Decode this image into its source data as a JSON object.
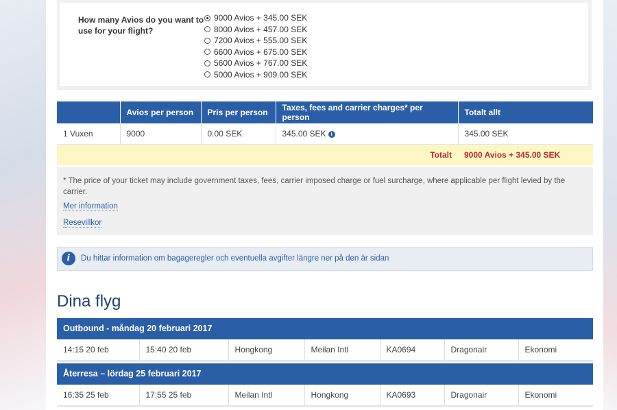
{
  "avios_selector": {
    "question": "How many Avios do you want to use for your flight?",
    "options": [
      {
        "label": "9000 Avios + 345.00 SEK",
        "selected": true
      },
      {
        "label": "8000 Avios + 457.00 SEK",
        "selected": false
      },
      {
        "label": "7200 Avios + 555.00 SEK",
        "selected": false
      },
      {
        "label": "6600 Avios + 675.00 SEK",
        "selected": false
      },
      {
        "label": "5600 Avios + 767.00 SEK",
        "selected": false
      },
      {
        "label": "5000 Avios + 909.00 SEK",
        "selected": false
      }
    ]
  },
  "price_table": {
    "headers": [
      "",
      "Avios per person",
      "Pris per person",
      "Taxes, fees and carrier charges* per person",
      "Totalt allt"
    ],
    "row": {
      "passenger": "1 Vuxen",
      "avios": "9000",
      "price": "0.00 SEK",
      "taxes": "345.00 SEK",
      "taxes_icon": "info-icon",
      "total": "345.00 SEK"
    },
    "total_label": "Totalt",
    "total_value": "9000 Avios + 345.00 SEK"
  },
  "footnote": {
    "text": "* The price of your ticket may include government taxes, fees, carrier imposed charge or fuel surcharge, where applicable per flight levied by the carrier.",
    "link_more": "Mer information",
    "link_terms": "Resevillkor"
  },
  "info_bar": {
    "icon": "info-icon",
    "text": "Du hittar information om bagageregler och eventuella avgifter längre ner på den är sidan"
  },
  "flights": {
    "title": "Dina flyg",
    "outbound": {
      "header": "Outbound - måndag 20 februari 2017",
      "departure": "14:15 20 feb",
      "arrival": "15:40 20 feb",
      "from": "Hongkong",
      "to": "Meilan Intl",
      "flight_no": "KA0694",
      "carrier": "Dragonair",
      "cabin": "Ekonomi"
    },
    "return": {
      "header": "Återresa – lördag 25 februari 2017",
      "departure": "16:35 25 feb",
      "arrival": "17:55 25 feb",
      "from": "Meilan Intl",
      "to": "Hongkong",
      "flight_no": "KA0693",
      "carrier": "Dragonair",
      "cabin": "Ekonomi"
    }
  },
  "colors": {
    "primary_blue": "#2a5fa8",
    "total_red": "#c0272d",
    "total_bg": "#fdf8c3",
    "title_blue": "#1d3f74"
  }
}
